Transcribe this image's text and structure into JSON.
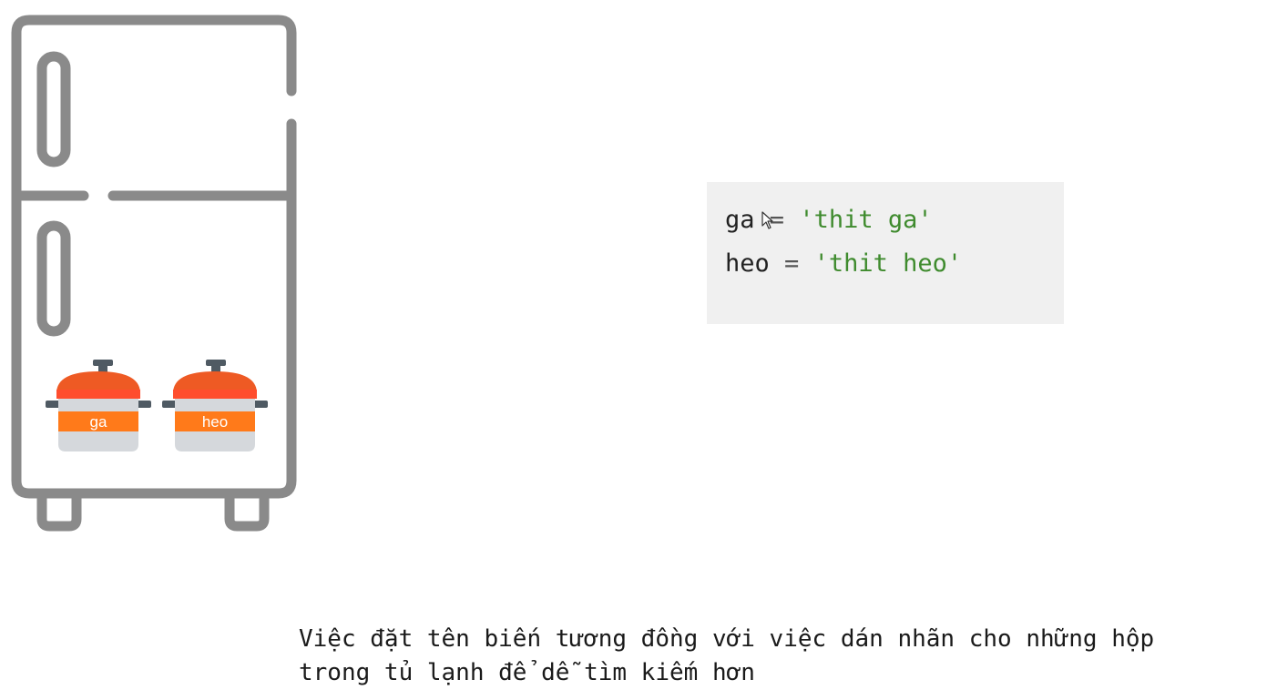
{
  "illustration": {
    "pots": [
      {
        "label": "ga"
      },
      {
        "label": "heo"
      }
    ],
    "colors": {
      "fridge_outline": "#8a8a8a",
      "pot_red": "#ee5a24",
      "pot_band": "#ff7a1a",
      "pot_body": "#d5d8dc",
      "pot_handle": "#4f5a63"
    }
  },
  "code": {
    "lines": [
      {
        "name": "ga",
        "op": "=",
        "value": "'thit ga'"
      },
      {
        "name": "heo",
        "op": "=",
        "value": "'thit heo'"
      }
    ],
    "string_color": "#3f8b2e"
  },
  "caption": {
    "line1": "Việc đặt tên biến tương đồng với việc dán nhãn cho những hộp",
    "line2": "trong tủ lạnh để dễ tìm kiếm hơn"
  }
}
